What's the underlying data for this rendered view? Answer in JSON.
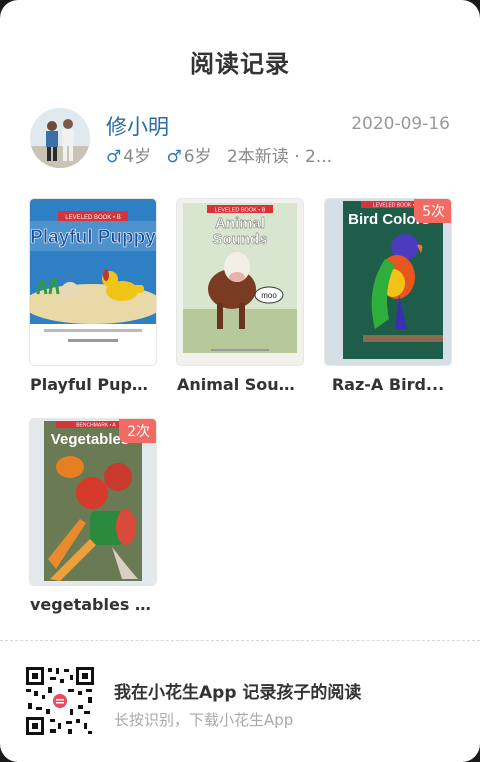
{
  "header": {
    "title": "阅读记录"
  },
  "profile": {
    "name": "修小明",
    "date": "2020-09-16",
    "kids": [
      {
        "gender_symbol": "♂",
        "age": "4岁"
      },
      {
        "gender_symbol": "♂",
        "age": "6岁"
      }
    ],
    "summary": "2本新读 · 2..."
  },
  "books": [
    {
      "title": "Playful Pupp...",
      "badge": "",
      "cover_banner": "LEVELED BOOK • B",
      "cover_title": "Playful Puppy"
    },
    {
      "title": "Animal Soun...",
      "badge": "",
      "cover_banner": "LEVELED BOOK • B",
      "cover_title": "Animal Sounds",
      "cover_bubble": "moo"
    },
    {
      "title": "Raz-A   Bird...",
      "badge": "5次",
      "cover_banner": "LEVELED BOOK • B",
      "cover_title": "Bird Colors"
    },
    {
      "title": "vegetables (...",
      "badge": "2次",
      "cover_banner": "BENCHMARK • A",
      "cover_title": "Vegetables"
    }
  ],
  "footer": {
    "main": "我在小花生App 记录孩子的阅读",
    "sub": "长按识别，下载小花生App"
  },
  "colors": {
    "accent_blue": "#2a6aa5",
    "badge": "#f36a63"
  }
}
